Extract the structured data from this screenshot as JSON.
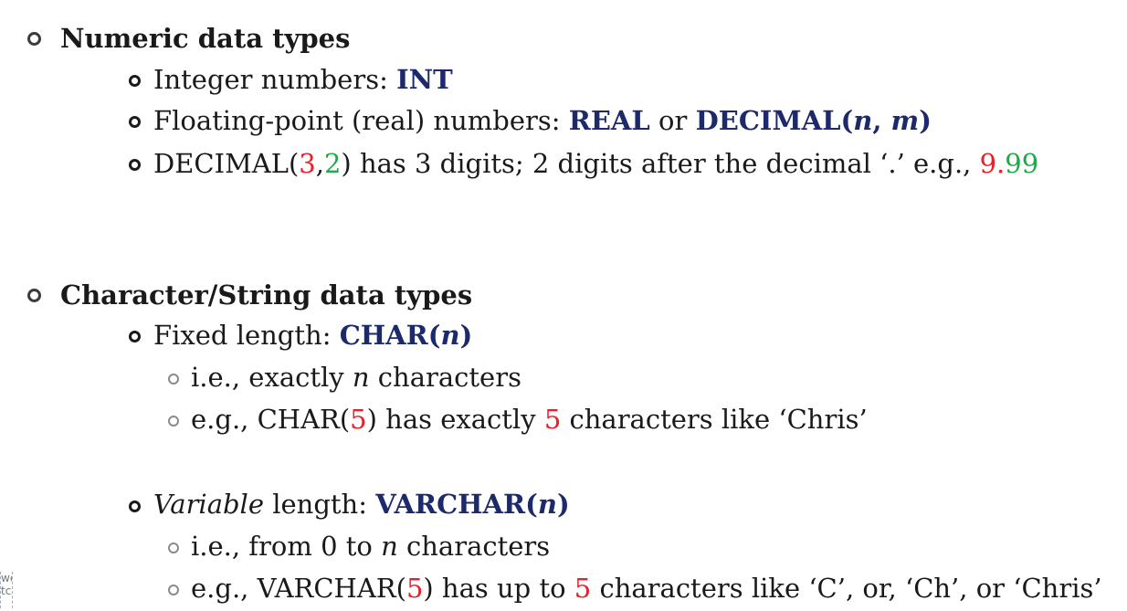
{
  "sections": [
    {
      "heading": "Numeric data types",
      "items": [
        {
          "prefix": "Integer numbers: ",
          "kw1": "INT"
        },
        {
          "prefix": "Floating-point (real) numbers: ",
          "kw1": "REAL",
          "mid": " or ",
          "kw2a": "DECIMAL(",
          "kw2b": "n",
          "kw2c": ", ",
          "kw2d": "m",
          "kw2e": ")"
        },
        {
          "p1": "DECIMAL(",
          "d1": "3",
          "comma": ",",
          "d2": "2",
          "p2": ") has 3 digits; 2 digits after the decimal ‘.’ e.g., ",
          "e1": "9.",
          "e2": "99"
        }
      ]
    },
    {
      "heading": "Character/String data types",
      "fixed": {
        "prefix": "Fixed length: ",
        "kwa": "CHAR(",
        "kwb": "n",
        "kwc": ")",
        "sub1a": "i.e., exactly ",
        "sub1b": "n",
        "sub1c": " characters",
        "sub2a": "e.g., CHAR(",
        "sub2b": "5",
        "sub2c": ") has exactly ",
        "sub2d": "5",
        "sub2e": " characters like ‘Chris’"
      },
      "variable": {
        "prefixa": "Variable",
        "prefixb": " length: ",
        "kwa": "VARCHAR(",
        "kwb": "n",
        "kwc": ")",
        "sub1a": "i.e., from 0 to ",
        "sub1b": "n",
        "sub1c": " characters",
        "sub2a": "e.g., VARCHAR(",
        "sub2b": "5",
        "sub2c": ") has up to ",
        "sub2d": "5",
        "sub2e": " characters like ‘C’, or, ‘Ch’, or ‘Chris’"
      }
    }
  ],
  "corner": {
    "line1": "we",
    "line2": "tc"
  }
}
